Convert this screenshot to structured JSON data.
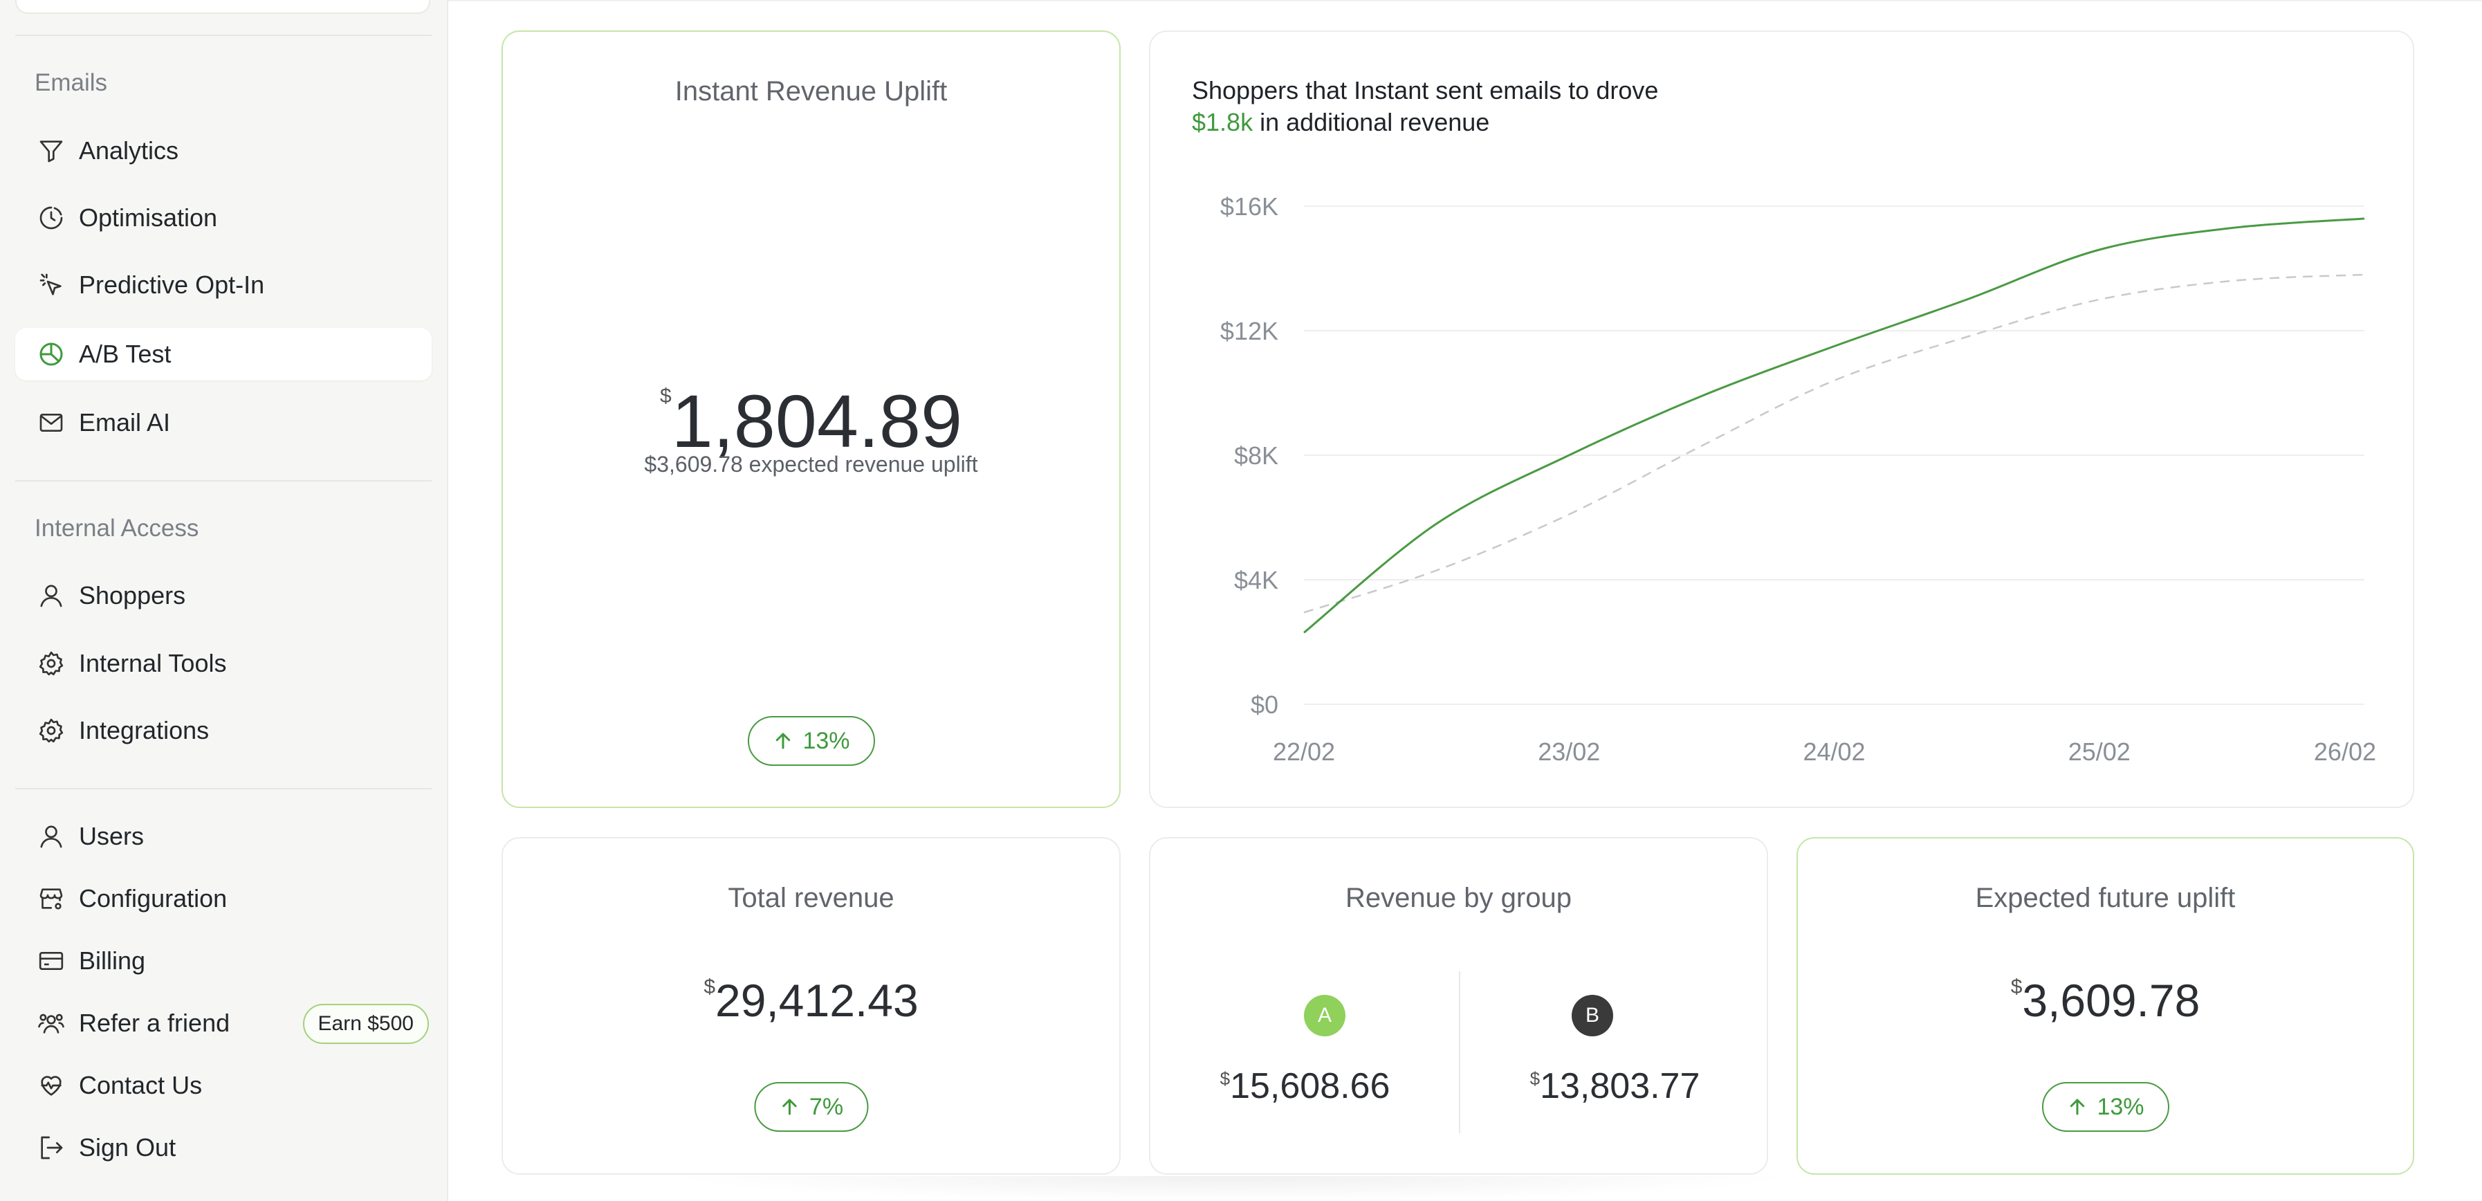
{
  "sidebar": {
    "emails_section": "Emails",
    "internal_section": "Internal Access",
    "emails_items": [
      {
        "label": "Analytics",
        "icon": "funnel-icon"
      },
      {
        "label": "Optimisation",
        "icon": "clock-pie-icon"
      },
      {
        "label": "Predictive Opt-In",
        "icon": "cursor-click-icon"
      },
      {
        "label": "A/B Test",
        "icon": "pie-chart-icon",
        "active": true
      },
      {
        "label": "Email AI",
        "icon": "mail-icon"
      }
    ],
    "internal_items": [
      {
        "label": "Shoppers",
        "icon": "user-icon"
      },
      {
        "label": "Internal Tools",
        "icon": "gear-icon"
      },
      {
        "label": "Integrations",
        "icon": "gear-icon"
      }
    ],
    "account_items": [
      {
        "label": "Users",
        "icon": "user-icon"
      },
      {
        "label": "Configuration",
        "icon": "store-settings-icon"
      },
      {
        "label": "Billing",
        "icon": "credit-card-icon"
      },
      {
        "label": "Refer a friend",
        "icon": "users-icon",
        "badge": "Earn $500"
      },
      {
        "label": "Contact Us",
        "icon": "heart-pulse-icon"
      },
      {
        "label": "Sign Out",
        "icon": "sign-out-icon"
      }
    ]
  },
  "uplift_card": {
    "title": "Instant Revenue Uplift",
    "currency": "$",
    "value": "1,804.89",
    "subtitle": "$3,609.78 expected revenue uplift",
    "change": "13%"
  },
  "chart_card": {
    "headline_line1": "Shoppers that Instant sent emails to drove",
    "headline_highlight": "$1.8k",
    "headline_rest": " in additional revenue"
  },
  "chart_data": {
    "type": "line",
    "title": "",
    "x": [
      "22/02",
      "23/02",
      "24/02",
      "25/02",
      "26/02"
    ],
    "yticks": [
      "$0",
      "$4K",
      "$8K",
      "$12K",
      "$16K"
    ],
    "ylim": [
      0,
      16000
    ],
    "grid": true,
    "series": [
      {
        "style": "solid",
        "color": "#4a9a43",
        "x": [
          0,
          0.5,
          1,
          1.5,
          2,
          2.5,
          3,
          3.5,
          4
        ],
        "values": [
          2300,
          5800,
          8000,
          9900,
          11500,
          13000,
          14600,
          15300,
          15600
        ]
      },
      {
        "style": "dashed",
        "color": "#c9c9c9",
        "x": [
          0,
          0.5,
          1,
          1.5,
          2,
          2.5,
          3,
          3.5,
          4
        ],
        "values": [
          2950,
          4300,
          6100,
          8300,
          10400,
          11800,
          13000,
          13600,
          13800
        ]
      }
    ]
  },
  "total_card": {
    "title": "Total revenue",
    "currency": "$",
    "value": "29,412.43",
    "change": "7%"
  },
  "group_card": {
    "title": "Revenue by group",
    "a_label": "A",
    "b_label": "B",
    "currency": "$",
    "a_value": "15,608.66",
    "b_value": "13,803.77",
    "a_color": "#8fd15b",
    "b_color": "#3a3a3a"
  },
  "future_card": {
    "title": "Expected future uplift",
    "currency": "$",
    "value": "3,609.78",
    "change": "13%"
  }
}
